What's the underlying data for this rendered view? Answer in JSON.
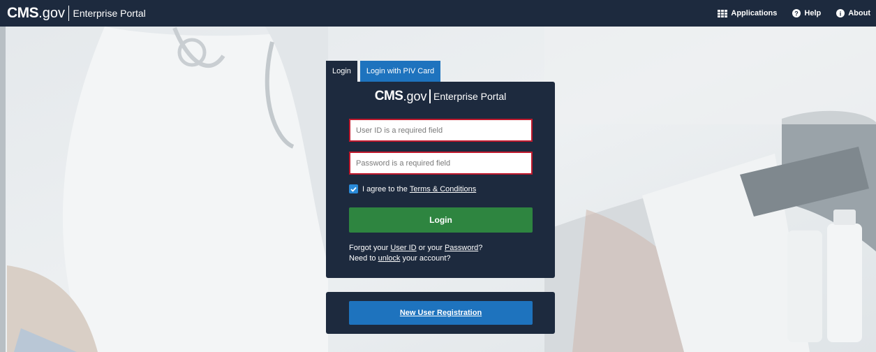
{
  "header": {
    "brand_cms": "CMS",
    "brand_dotgov": ".gov",
    "brand_portal": "Enterprise Portal",
    "nav": [
      {
        "label": "Applications",
        "icon": "grid-icon"
      },
      {
        "label": "Help",
        "icon": "question-circle-icon"
      },
      {
        "label": "About",
        "icon": "info-circle-icon"
      }
    ]
  },
  "tabs": [
    {
      "label": "Login",
      "active": true
    },
    {
      "label": "Login with PIV Card",
      "active": false
    }
  ],
  "login": {
    "brand_cms": "CMS",
    "brand_dotgov": ".gov",
    "brand_portal": "Enterprise Portal",
    "user_id_placeholder": "User ID is a required field",
    "user_id_value": "",
    "password_placeholder": "Password is a required field",
    "password_value": "",
    "terms_checked": true,
    "terms_prefix": "I agree to the",
    "terms_link": "Terms & Conditions",
    "login_button": "Login",
    "forgot_prefix": "Forgot your",
    "forgot_userid_link": "User ID",
    "forgot_middle": "or your",
    "forgot_password_link": "Password",
    "forgot_suffix": "?",
    "unlock_prefix": "Need to",
    "unlock_link": "unlock",
    "unlock_suffix": "your account?"
  },
  "registration": {
    "button": "New User Registration"
  },
  "colors": {
    "navy": "#1d2a3e",
    "login_green": "#2e8540",
    "primary_blue": "#1e73be",
    "error_red": "#c0192d"
  }
}
